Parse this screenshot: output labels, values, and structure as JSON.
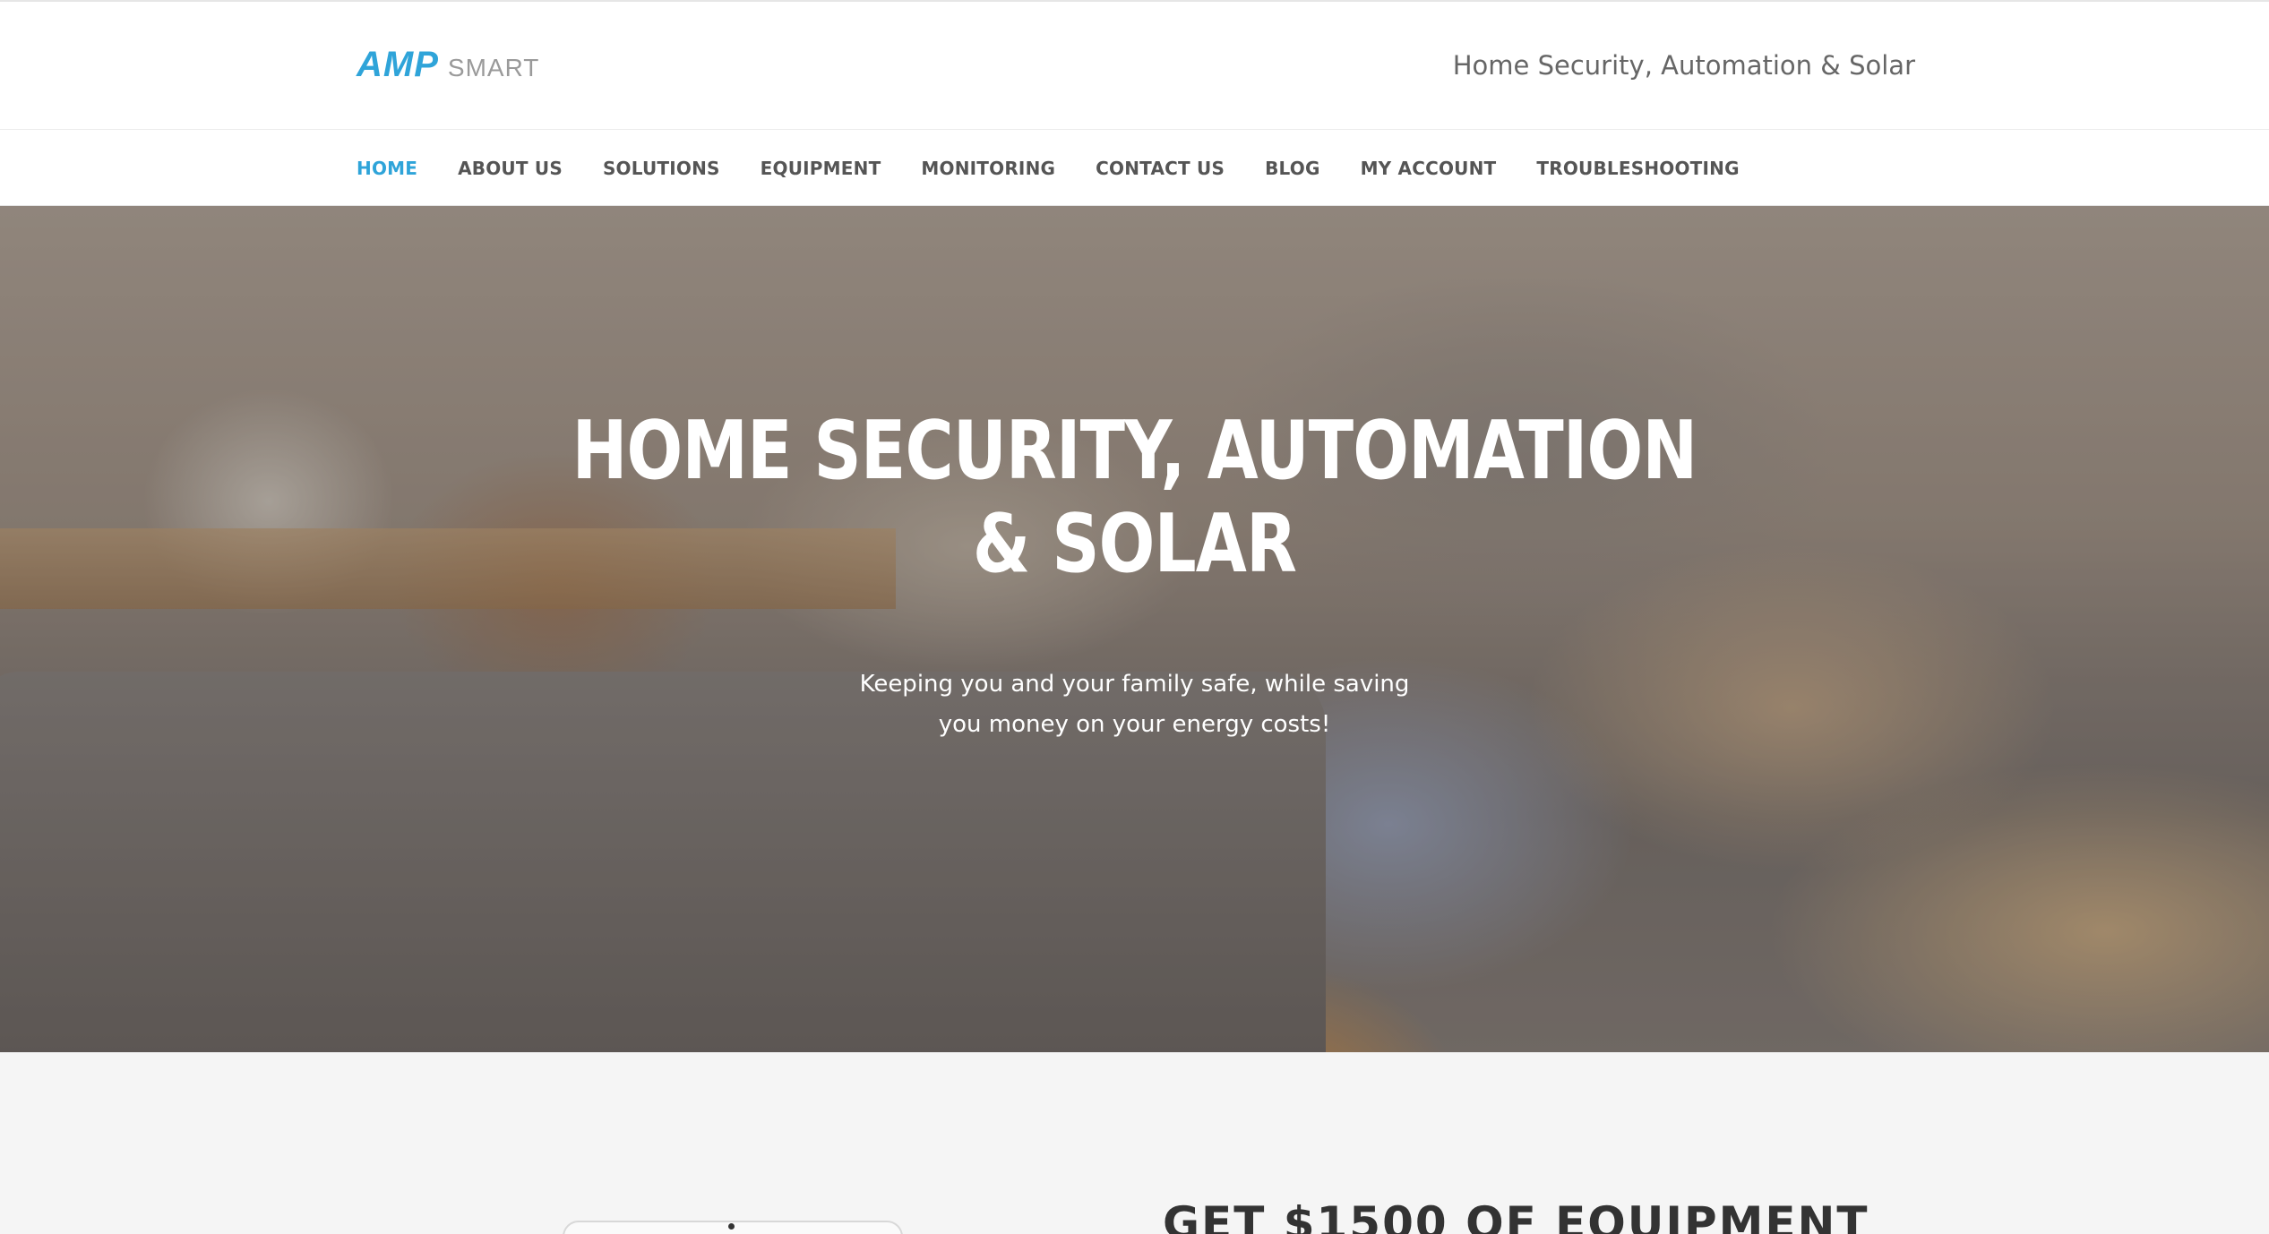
{
  "colors": {
    "brand_blue": "#2fa4d9",
    "logo_gray": "#9a9a9a",
    "nav_text": "#555555",
    "nav_active": "#2fa4d9",
    "tagline": "#666666",
    "hero_text": "#ffffff",
    "promo_text": "#333333"
  },
  "header": {
    "logo": {
      "amp": "AMP",
      "smart": "SMART"
    },
    "tagline": "Home Security, Automation & Solar"
  },
  "nav": {
    "items": [
      {
        "label": "HOME",
        "active": true
      },
      {
        "label": "ABOUT US",
        "active": false
      },
      {
        "label": "SOLUTIONS",
        "active": false
      },
      {
        "label": "EQUIPMENT",
        "active": false
      },
      {
        "label": "MONITORING",
        "active": false
      },
      {
        "label": "CONTACT US",
        "active": false
      },
      {
        "label": "BLOG",
        "active": false
      },
      {
        "label": "MY ACCOUNT",
        "active": false
      },
      {
        "label": "TROUBLESHOOTING",
        "active": false
      }
    ]
  },
  "hero": {
    "title_line1": "HOME SECURITY, AUTOMATION",
    "title_line2": "& SOLAR",
    "subtitle_line1": "Keeping you and your family safe, while saving",
    "subtitle_line2": "you money on your energy costs!"
  },
  "promo": {
    "heading": "GET $1500 OF EQUIPMENT"
  }
}
